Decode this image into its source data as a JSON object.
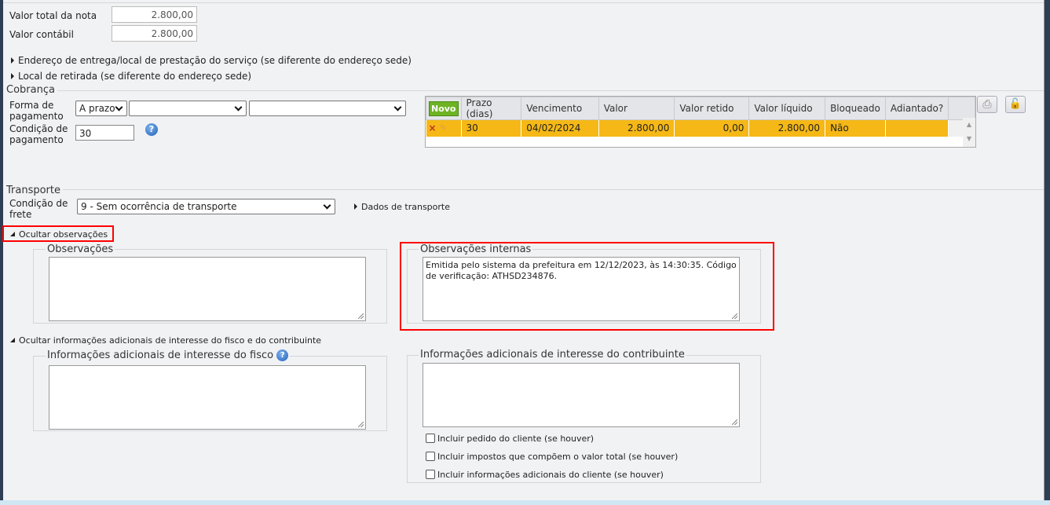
{
  "totals": {
    "valor_total_label": "Valor total da nota",
    "valor_total": "2.800,00",
    "valor_contabil_label": "Valor contábil",
    "valor_contabil": "2.800,00"
  },
  "links": {
    "endereco_entrega": "Endereço de entrega/local de prestação do serviço (se diferente do endereço sede)",
    "local_retirada": "Local de retirada (se diferente do endereço sede)"
  },
  "cobranca": {
    "title": "Cobrança",
    "forma_label": "Forma de pagamento",
    "forma_value": "A prazo",
    "forma_sel2": "",
    "forma_sel3": "",
    "condicao_label": "Condição de pagamento",
    "condicao_value": "30",
    "table": {
      "novo": "Novo",
      "headers": [
        "Prazo (dias)",
        "Vencimento",
        "Valor",
        "Valor retido",
        "Valor líquido",
        "Bloqueado",
        "Adiantado?"
      ],
      "rows": [
        [
          "30",
          "04/02/2024",
          "2.800,00",
          "0,00",
          "2.800,00",
          "Não",
          ""
        ]
      ]
    }
  },
  "transporte": {
    "title": "Transporte",
    "condicao_label": "Condição de frete",
    "condicao_value": "9 - Sem ocorrência de transporte",
    "dados": "Dados de transporte"
  },
  "obs": {
    "toggle": "Ocultar observações",
    "observacoes_label": "Observações",
    "observacoes_value": "",
    "internas_label": "Observações internas",
    "internas_value": "Emitida pelo sistema da prefeitura em 12/12/2023, às 14:30:35. Código de verificação: ATHSD234876."
  },
  "info": {
    "toggle": "Ocultar informações adicionais de interesse do fisco e do contribuinte",
    "fisco_label": "Informações adicionais de interesse do fisco",
    "fisco_value": "",
    "contrib_label": "Informações adicionais de interesse do contribuinte",
    "contrib_value": "",
    "checks": [
      "Incluir pedido do cliente (se houver)",
      "Incluir impostos que compõem o valor total (se houver)",
      "Incluir informações adicionais do cliente (se houver)"
    ]
  },
  "colors": {
    "accent_row": "#f5b816",
    "novo": "#6db324",
    "highlight": "#ff0000"
  }
}
